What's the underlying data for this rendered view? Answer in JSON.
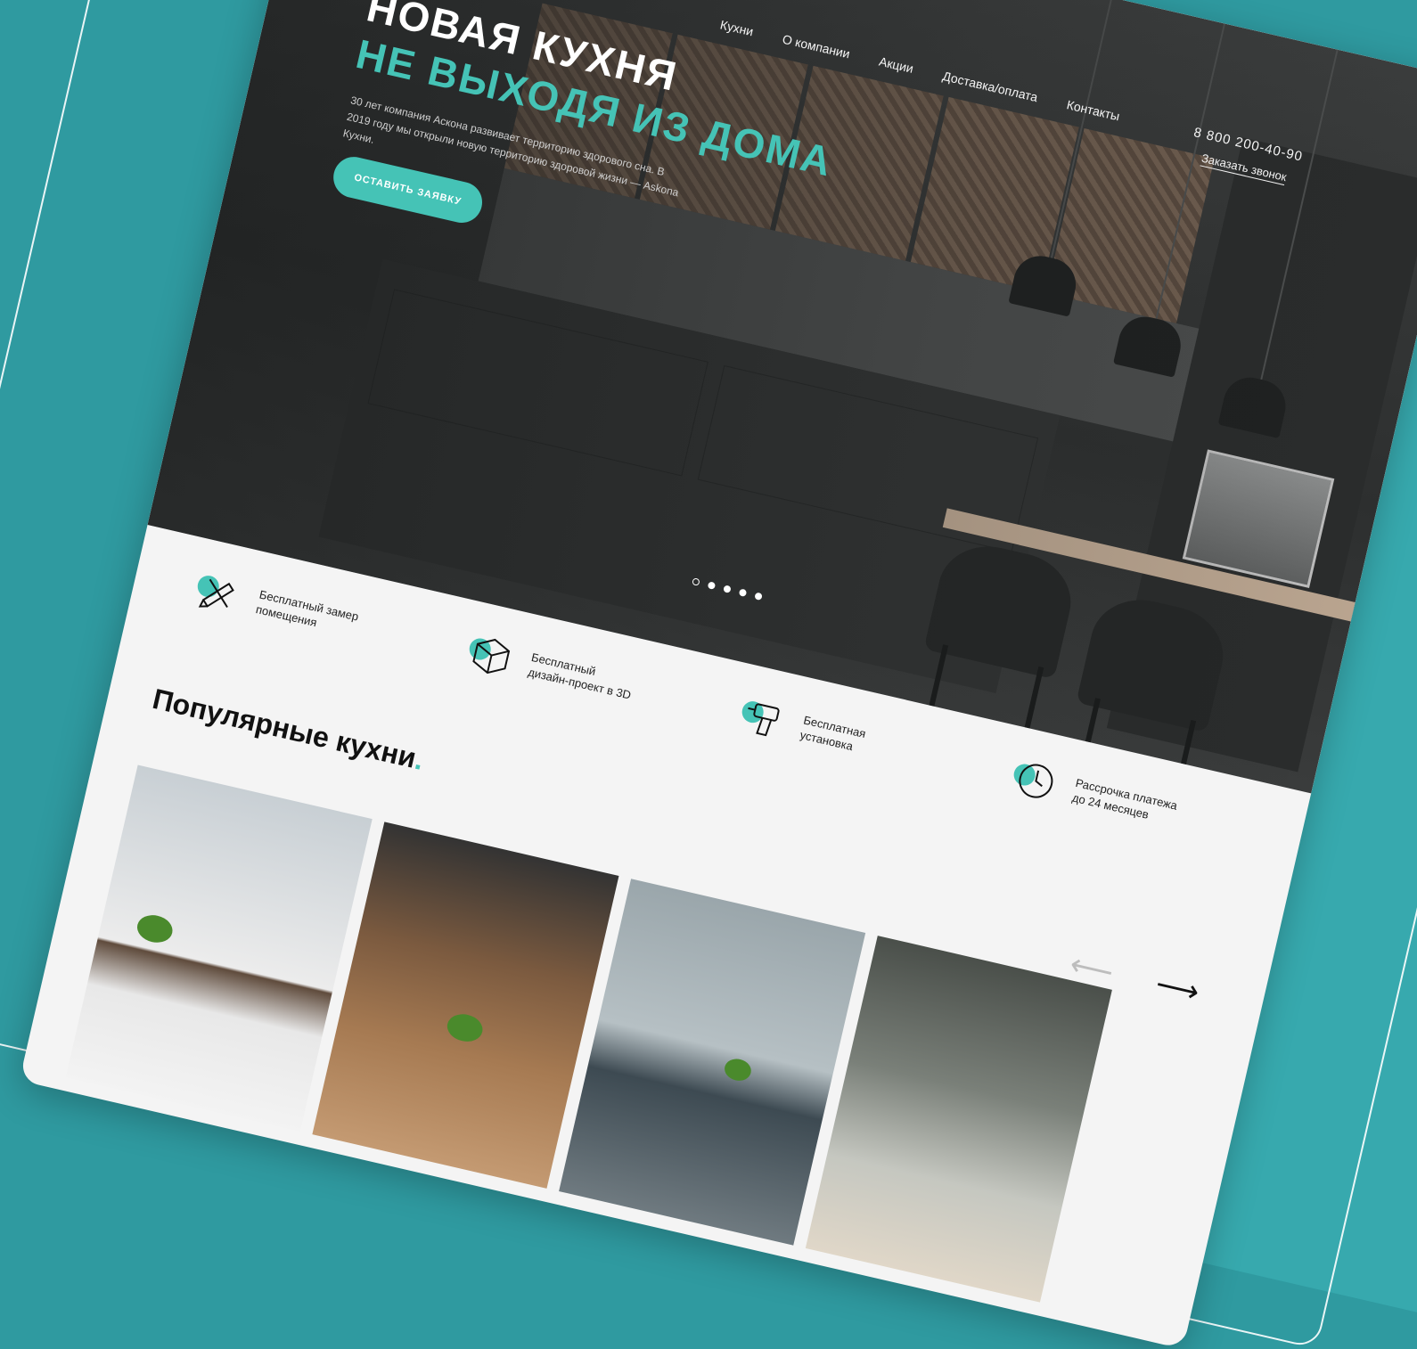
{
  "nav": {
    "items": [
      "Кухни",
      "О компании",
      "Акции",
      "Доставка/оплата",
      "Контакты"
    ]
  },
  "header": {
    "phone": "8 800 200-40-90",
    "callback_label": "Заказать звонок"
  },
  "hero": {
    "title_line1": "НОВАЯ КУХНЯ",
    "title_line2": "НЕ ВЫХОДЯ ИЗ ДОМА",
    "lead": "30 лет компания Аскона развивает территорию здорового сна. В 2019 году мы открыли новую территорию здоровой жизни — Askona Кухни.",
    "cta_label": "Оставить заявку",
    "slides": 5,
    "active_slide": 1
  },
  "features": [
    {
      "icon": "pencil-ruler-icon",
      "text": "Бесплатный замер\nпомещения"
    },
    {
      "icon": "cube-icon",
      "text": "Бесплатный\nдизайн-проект в 3D"
    },
    {
      "icon": "drill-icon",
      "text": "Бесплатная\nустановка"
    },
    {
      "icon": "clock-icon",
      "text": "Рассрочка платежа\nдо 24 месяцев"
    }
  ],
  "popular": {
    "title": "Популярные кухни",
    "title_dot": "."
  },
  "colors": {
    "accent": "#45c3b6",
    "background": "#2f9aa0",
    "panel": "#37a9ae",
    "page": "#f4f4f4"
  }
}
